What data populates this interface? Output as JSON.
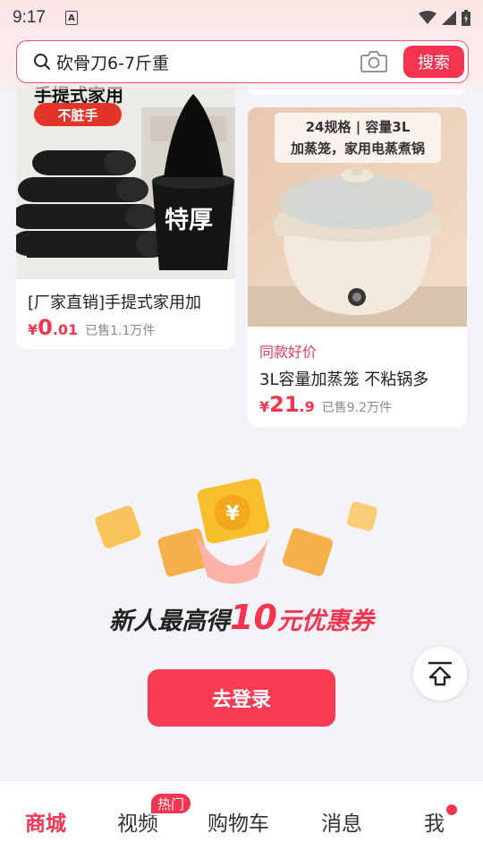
{
  "status_bar": {
    "time": "9:17",
    "indicator": "A"
  },
  "search": {
    "value": "砍骨刀6-7斤重",
    "button_label": "搜索"
  },
  "products": [
    {
      "title": "[厂家直销]手提式家用加",
      "price_symbol": "¥",
      "price_int": "0",
      "price_dec": ".01",
      "sold": "已售1.1万件",
      "image_text_1": "手提式家用",
      "image_text_2": "不脏手",
      "image_text_3": "特厚"
    },
    {
      "tag": "同款好价",
      "title": "3L容量加蒸笼 不粘锅多",
      "price_symbol": "¥",
      "price_int": "21",
      "price_dec": ".9",
      "sold": "已售9.2万件",
      "image_text_1": "24规格 | 容量3L",
      "image_text_2": "加蒸笼，家用电蒸煮锅"
    }
  ],
  "promo": {
    "text_before": "新人最高得",
    "amount": "10",
    "text_after": "元优惠券",
    "button_label": "去登录"
  },
  "tabs": [
    {
      "label": "商城",
      "active": true
    },
    {
      "label": "视频",
      "badge": "热门"
    },
    {
      "label": "购物车"
    },
    {
      "label": "消息"
    },
    {
      "label": "我"
    }
  ],
  "colors": {
    "accent": "#f5344f",
    "background": "#f4f4f8"
  },
  "icons": [
    "wifi-icon",
    "signal-icon",
    "battery-icon",
    "search-icon",
    "camera-icon",
    "back-to-top-icon"
  ]
}
